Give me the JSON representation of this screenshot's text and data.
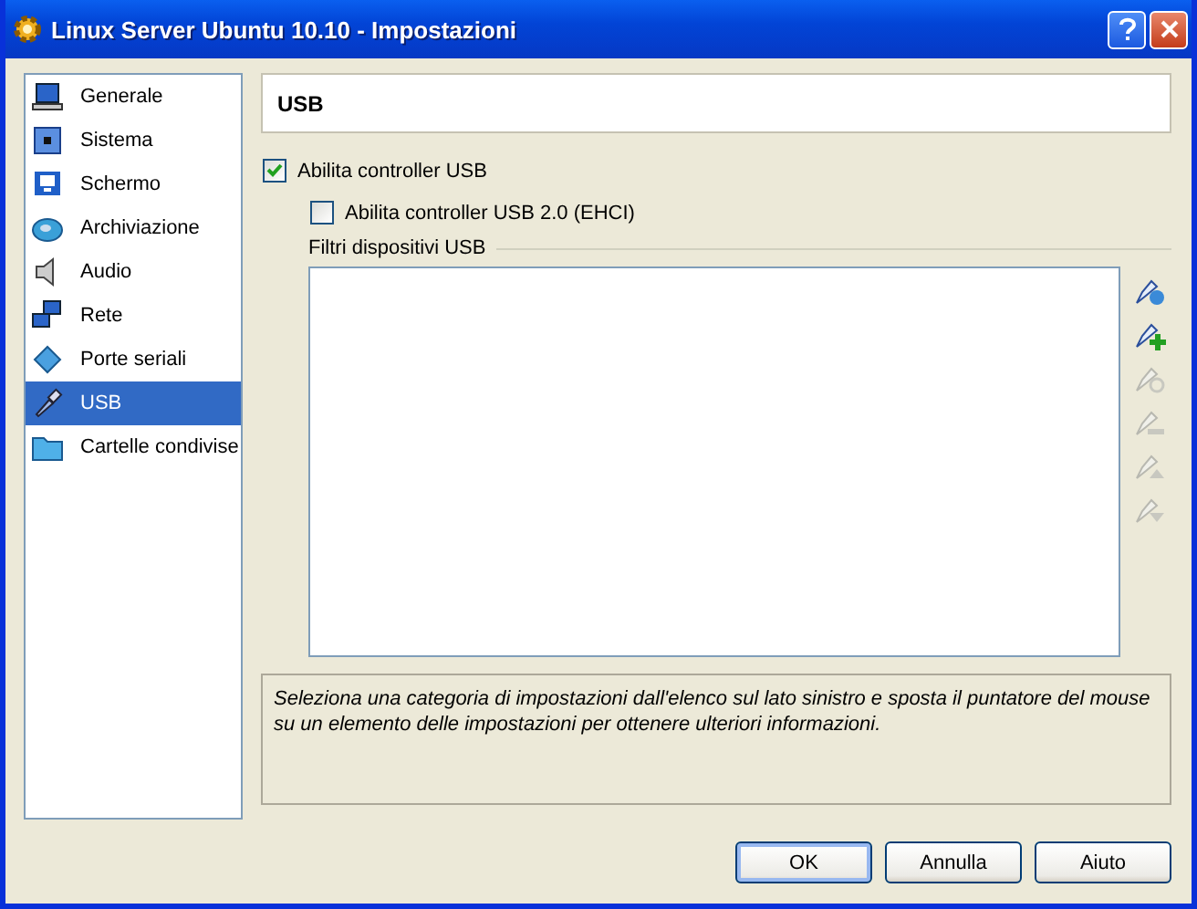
{
  "window": {
    "title": "Linux Server Ubuntu 10.10 - Impostazioni"
  },
  "sidebar": {
    "items": [
      {
        "label": "Generale",
        "kind": "computer",
        "selected": false
      },
      {
        "label": "Sistema",
        "kind": "chip",
        "selected": false
      },
      {
        "label": "Schermo",
        "kind": "monitor",
        "selected": false
      },
      {
        "label": "Archiviazione",
        "kind": "disk",
        "selected": false
      },
      {
        "label": "Audio",
        "kind": "speaker",
        "selected": false
      },
      {
        "label": "Rete",
        "kind": "network",
        "selected": false
      },
      {
        "label": "Porte seriali",
        "kind": "serial",
        "selected": false
      },
      {
        "label": "USB",
        "kind": "usb",
        "selected": true
      },
      {
        "label": "Cartelle condivise",
        "kind": "folder",
        "selected": false
      }
    ]
  },
  "page": {
    "title": "USB",
    "options": [
      {
        "label": "Abilita controller USB",
        "checked": true,
        "indent": false
      },
      {
        "label": "Abilita controller USB 2.0 (EHCI)",
        "checked": false,
        "indent": true
      }
    ],
    "filters": {
      "label": "Filtri dispositivi USB",
      "tools": [
        {
          "kind": "new",
          "disabled": false
        },
        {
          "kind": "add",
          "disabled": false
        },
        {
          "kind": "edit",
          "disabled": true
        },
        {
          "kind": "remove",
          "disabled": true
        },
        {
          "kind": "up",
          "disabled": true
        },
        {
          "kind": "down",
          "disabled": true
        }
      ]
    },
    "info": "Seleziona una categoria di impostazioni dall'elenco sul lato sinistro e sposta il puntatore del mouse su un elemento delle impostazioni per ottenere ulteriori informazioni."
  },
  "buttons": [
    {
      "label": "OK",
      "default": true
    },
    {
      "label": "Annulla",
      "default": false
    },
    {
      "label": "Aiuto",
      "default": false
    }
  ]
}
